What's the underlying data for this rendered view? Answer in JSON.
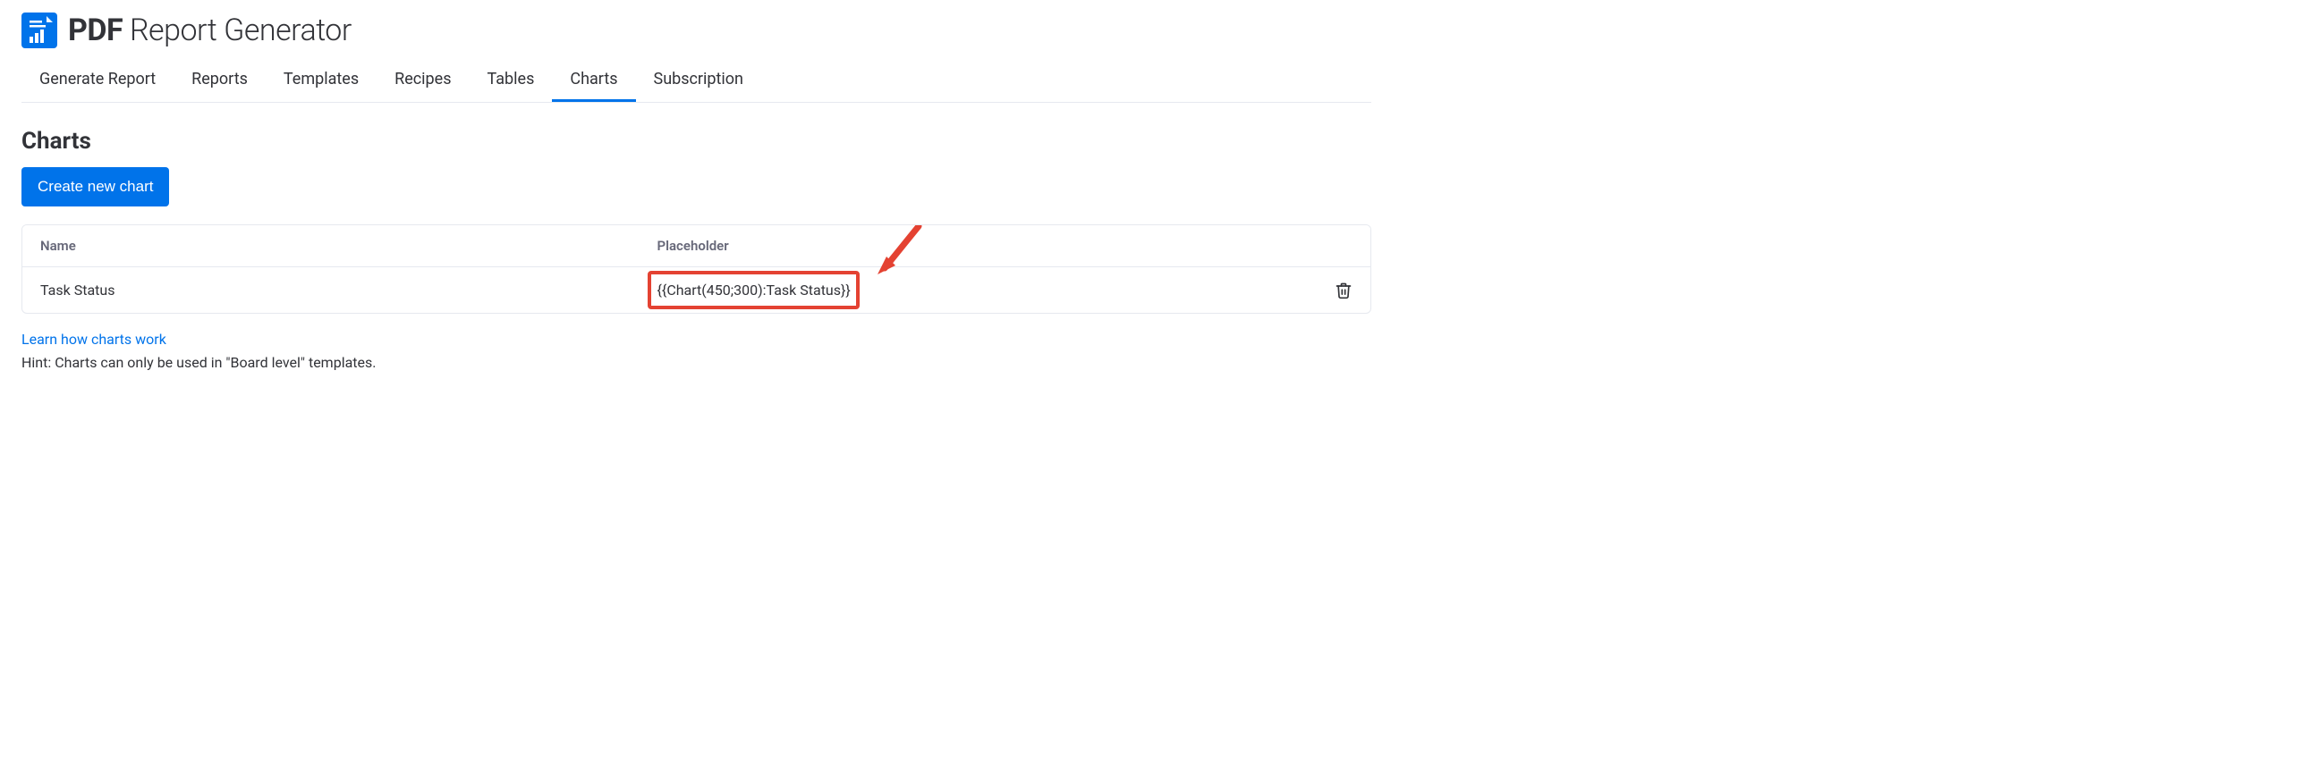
{
  "header": {
    "title_bold": "PDF",
    "title_light": " Report Generator"
  },
  "tabs": [
    {
      "label": "Generate Report",
      "active": false
    },
    {
      "label": "Reports",
      "active": false
    },
    {
      "label": "Templates",
      "active": false
    },
    {
      "label": "Recipes",
      "active": false
    },
    {
      "label": "Tables",
      "active": false
    },
    {
      "label": "Charts",
      "active": true
    },
    {
      "label": "Subscription",
      "active": false
    }
  ],
  "page": {
    "title": "Charts",
    "create_button": "Create new chart"
  },
  "table": {
    "columns": {
      "name": "Name",
      "placeholder": "Placeholder"
    },
    "rows": [
      {
        "name": "Task Status",
        "placeholder": "{{Chart(450;300):Task Status}}"
      }
    ]
  },
  "footer": {
    "link_text": "Learn how charts work",
    "hint": "Hint: Charts can only be used in \"Board level\" templates."
  },
  "colors": {
    "primary": "#0073ea",
    "highlight": "#e44232",
    "text": "#323338",
    "muted": "#676879",
    "border": "#e6e9ef"
  }
}
